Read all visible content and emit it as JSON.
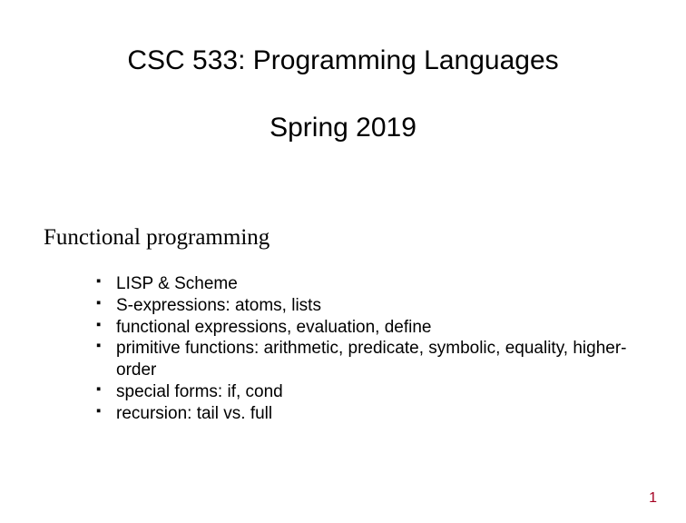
{
  "title": "CSC 533: Programming Languages",
  "subtitle": "Spring 2019",
  "section_heading": "Functional programming",
  "bullets": [
    "LISP & Scheme",
    "S-expressions:  atoms, lists",
    "functional expressions, evaluation, define",
    "primitive functions:  arithmetic, predicate, symbolic, equality, higher-order",
    "special forms: if, cond",
    "recursion: tail vs. full"
  ],
  "page_number": "1"
}
